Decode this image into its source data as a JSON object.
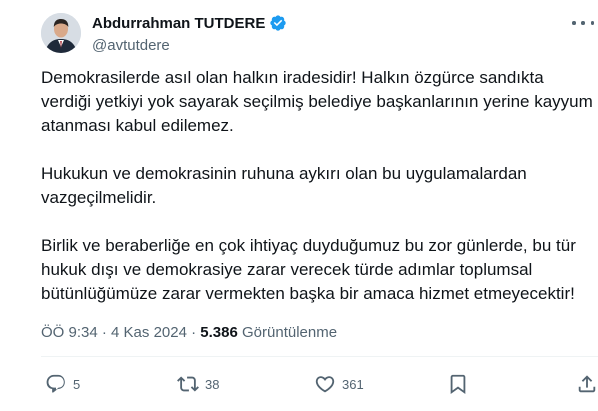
{
  "author": {
    "display_name": "Abdurrahman TUTDERE",
    "handle": "@avtutdere",
    "verified_color": "#1d9bf0"
  },
  "tweet": {
    "paragraphs": [
      [
        "Demokrasilerde asıl olan halkın iradesidir! Halkın özgürce sandıkta",
        "verdiği yetkiyi yok sayarak seçilmiş belediye başkanlarının yerine kayyum",
        "atanması kabul edilemez."
      ],
      [
        "Hukukun ve demokrasinin ruhuna aykırı olan bu uygulamalardan",
        "vazgeçilmelidir."
      ],
      [
        "Birlik ve beraberliğe en çok ihtiyaç duyduğumuz bu zor günlerde, bu tür",
        "hukuk dışı ve demokrasiye zarar verecek türde adımlar toplumsal",
        "bütünlüğümüze zarar vermekten başka bir amaca hizmet etmeyecektir!"
      ]
    ]
  },
  "meta": {
    "time": "ÖÖ 9:34",
    "separator": "·",
    "date": "4 Kas 2024",
    "views_count": "5.386",
    "views_label": "Görüntülenme"
  },
  "actions": {
    "reply": {
      "icon": "reply-icon",
      "count": "5"
    },
    "retweet": {
      "icon": "retweet-icon",
      "count": "38"
    },
    "like": {
      "icon": "heart-icon",
      "count": "361"
    },
    "bookmark": {
      "icon": "bookmark-icon"
    },
    "share": {
      "icon": "share-icon"
    }
  }
}
